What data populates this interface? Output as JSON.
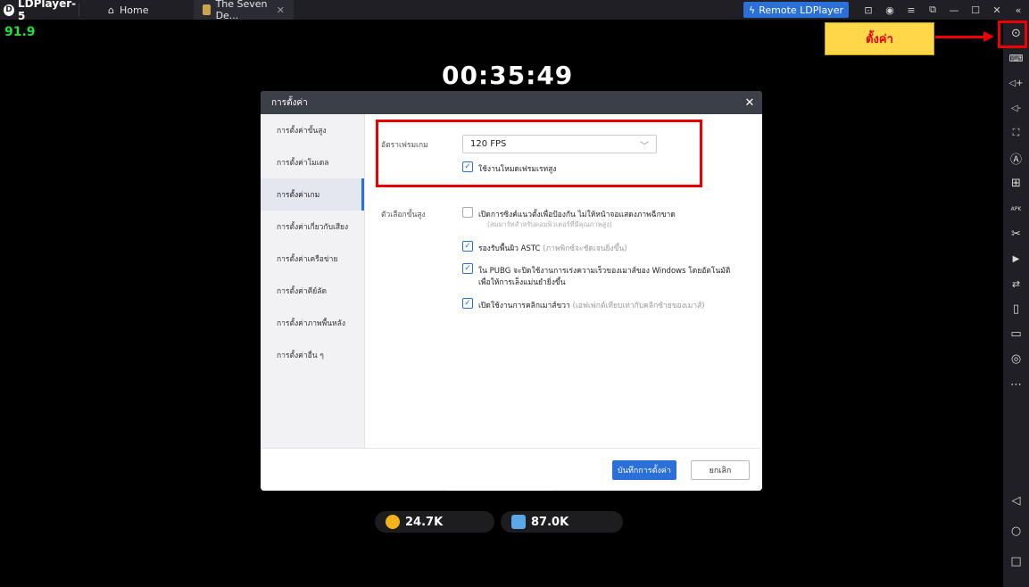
{
  "titlebar": {
    "app_name": "LDPlayer-5",
    "tabs": [
      {
        "label": "Home",
        "icon": "home-icon"
      },
      {
        "label": "The Seven De...",
        "icon": "game-thumbnail-icon"
      }
    ],
    "remote_label": "Remote LDPlayer"
  },
  "game": {
    "fps_value": "91.9",
    "timer": "00:35:49",
    "currency": [
      {
        "amount": "24.7K",
        "icon": "gold-coin-icon",
        "color": "#f2b21c"
      },
      {
        "amount": "87.0K",
        "icon": "gem-icon",
        "color": "#5aa8e8"
      }
    ]
  },
  "annotation": {
    "callout_label": "ตั้งค่า"
  },
  "dialog": {
    "title": "การตั้งค่า",
    "nav": [
      {
        "label": "การตั้งค่าขั้นสูง"
      },
      {
        "label": "การตั้งค่าโมเดล"
      },
      {
        "label": "การตั้งค่าเกม",
        "active": true
      },
      {
        "label": "การตั้งค่าเกี่ยวกับเสียง"
      },
      {
        "label": "การตั้งค่าเครือข่าย"
      },
      {
        "label": "การตั้งค่าคีย์ลัด"
      },
      {
        "label": "การตั้งค่าภาพพื้นหลัง"
      },
      {
        "label": "การตั้งค่าอื่น ๆ"
      }
    ],
    "frame_rate_label": "อัตราเฟรมเกม",
    "frame_rate_value": "120 FPS",
    "high_frame_rate": {
      "label": "ใช้งานโหมดเฟรมเรทสูง",
      "checked": true
    },
    "advanced_label": "ตัวเลือกขั้นสูง",
    "options": [
      {
        "label": "เปิดการซิงค์แนวตั้งเพื่อป้องกัน ไม่ให้หน้าจอแสดงภาพฉีกขาด",
        "hint": "(สมมาร์ทสำหรับคอมพิวเตอร์ที่มีคุณภาพสูง)",
        "checked": false
      },
      {
        "label": "รองรับพื้นผิว ASTC",
        "sub": "(ภาพพิกซ์จะชัดเจนยิ่งขึ้น)",
        "checked": true
      },
      {
        "label": "ใน PUBG จะปิดใช้งานการเร่งความเร็วของเมาส์ของ Windows โดยอัตโนมัติ",
        "label2": "เพื่อให้การเล็งแม่นยำยิ่งขึ้น",
        "checked": true
      },
      {
        "label": "เปิดใช้งานการคลิกเมาส์ขวา",
        "sub": "(เอฟเฟกต์เทียบเท่ากับคลิกซ้ายของเมาส์)",
        "checked": true
      }
    ],
    "save_label": "บันทึกการตั้งค่า",
    "cancel_label": "ยกเลิก"
  },
  "sidebar": {
    "items": [
      {
        "icon": "settings-icon",
        "glyph": "⊙"
      },
      {
        "icon": "keyboard-icon",
        "glyph": "⌨"
      },
      {
        "icon": "volume-up-icon",
        "glyph": "◁+"
      },
      {
        "icon": "volume-down-icon",
        "glyph": "◁-"
      },
      {
        "icon": "fullscreen-icon",
        "glyph": "⛶"
      },
      {
        "icon": "auto-click-icon",
        "glyph": "Ⓐ"
      },
      {
        "icon": "add-window-icon",
        "glyph": "⊞"
      },
      {
        "icon": "apk-install-icon",
        "glyph": "APK"
      },
      {
        "icon": "scissors-icon",
        "glyph": "✂"
      },
      {
        "icon": "record-icon",
        "glyph": "▶"
      },
      {
        "icon": "sync-icon",
        "glyph": "⇄"
      },
      {
        "icon": "shake-icon",
        "glyph": "▯"
      },
      {
        "icon": "folder-icon",
        "glyph": "▭"
      },
      {
        "icon": "location-icon",
        "glyph": "◎"
      },
      {
        "icon": "more-icon",
        "glyph": "⋯"
      }
    ],
    "bottom": [
      {
        "icon": "back-icon",
        "glyph": "◁"
      },
      {
        "icon": "home-nav-icon",
        "glyph": "○"
      },
      {
        "icon": "recent-apps-icon",
        "glyph": "□"
      }
    ]
  }
}
